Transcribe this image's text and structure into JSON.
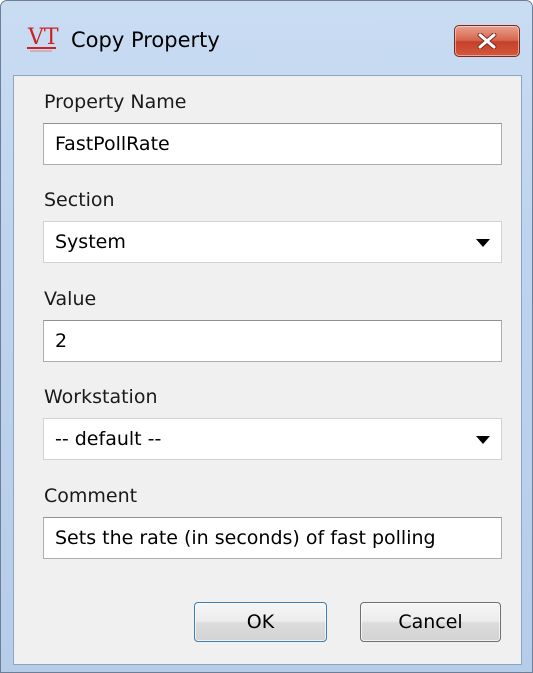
{
  "window": {
    "title": "Copy Property",
    "logo_text": "VT",
    "logo_color": "#cc2222"
  },
  "form": {
    "property_name": {
      "label": "Property Name",
      "value": "FastPollRate"
    },
    "section": {
      "label": "Section",
      "selected": "System"
    },
    "value": {
      "label": "Value",
      "value": "2"
    },
    "workstation": {
      "label": "Workstation",
      "selected": "-- default --"
    },
    "comment": {
      "label": "Comment",
      "value": "Sets the rate (in seconds) of fast polling"
    }
  },
  "buttons": {
    "ok": "OK",
    "cancel": "Cancel"
  },
  "icons": {
    "close": "close-icon",
    "dropdown": "chevron-down-icon"
  },
  "colors": {
    "close_button": "#c6402a",
    "default_button_border": "#3c7fb1"
  }
}
